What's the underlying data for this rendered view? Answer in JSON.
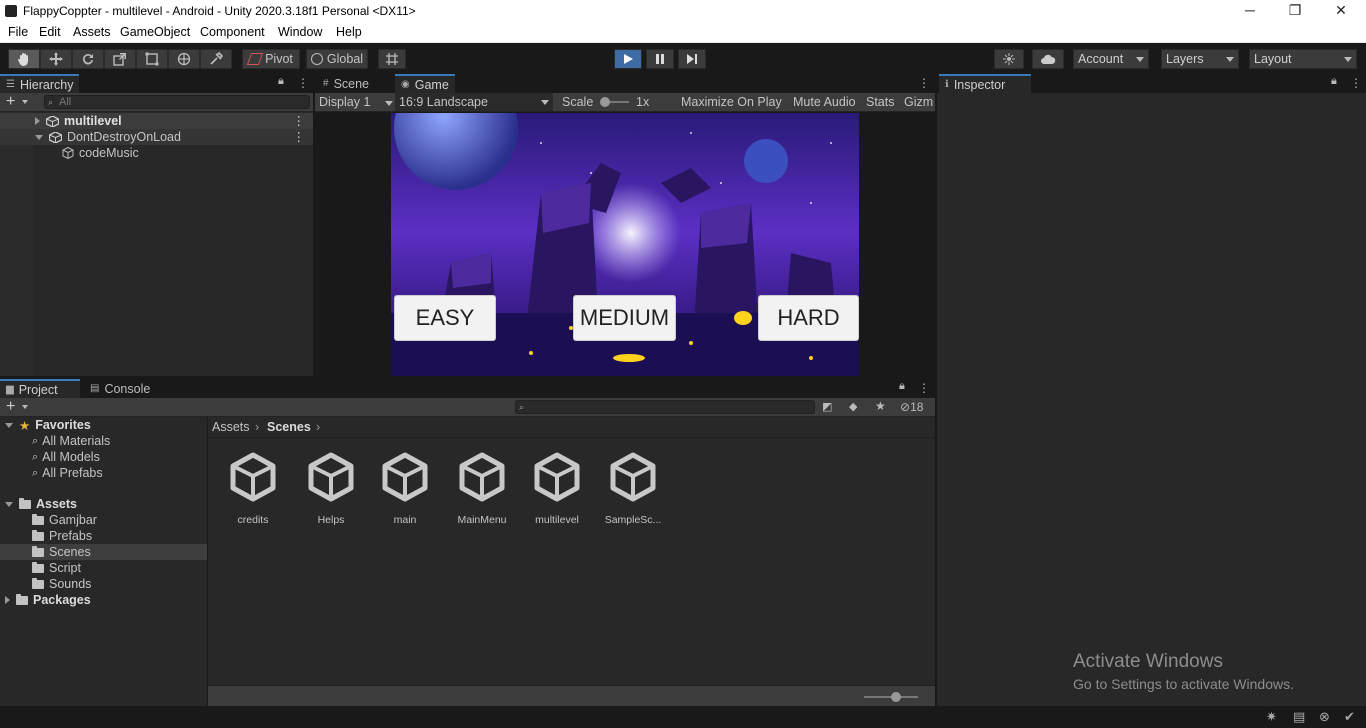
{
  "window": {
    "title": "FlappyCoppter - multilevel - Android - Unity 2020.3.18f1 Personal <DX11>",
    "minimize": "─",
    "maximize": "❐",
    "close": "✕"
  },
  "menu": [
    "File",
    "Edit",
    "Assets",
    "GameObject",
    "Component",
    "Window",
    "Help"
  ],
  "toolbar": {
    "pivot": "Pivot",
    "global": "Global",
    "account": "Account",
    "layers": "Layers",
    "layout": "Layout",
    "play_color": "#3d6ba4"
  },
  "hierarchy": {
    "tab": "Hierarchy",
    "search_placeholder": "All",
    "rows": [
      {
        "label": "multilevel"
      },
      {
        "label": "DontDestroyOnLoad"
      },
      {
        "label": "codeMusic"
      }
    ]
  },
  "game": {
    "tabs": [
      "Scene",
      "Game"
    ],
    "display": "Display 1",
    "aspect": "16:9 Landscape",
    "scale_label": "Scale",
    "scale_value": "1x",
    "maximize": "Maximize On Play",
    "mute": "Mute Audio",
    "stats": "Stats",
    "gizmos": "Gizm",
    "buttons": [
      "EASY",
      "MEDIUM",
      "HARD"
    ]
  },
  "inspector": {
    "tab": "Inspector"
  },
  "project": {
    "tabs": [
      "Project",
      "Console"
    ],
    "hidden_count": "18",
    "breadcrumb": [
      "Assets",
      "Scenes"
    ],
    "favorites": {
      "label": "Favorites",
      "items": [
        "All Materials",
        "All Models",
        "All Prefabs"
      ]
    },
    "assets": {
      "label": "Assets",
      "items": [
        "Gamjbar",
        "Prefabs",
        "Scenes",
        "Script",
        "Sounds"
      ],
      "selected": "Scenes"
    },
    "packages": "Packages",
    "files": [
      "credits",
      "Helps",
      "main",
      "MainMenu",
      "multilevel",
      "SampleSc..."
    ]
  },
  "watermark": {
    "line1": "Activate Windows",
    "line2": "Go to Settings to activate Windows."
  }
}
